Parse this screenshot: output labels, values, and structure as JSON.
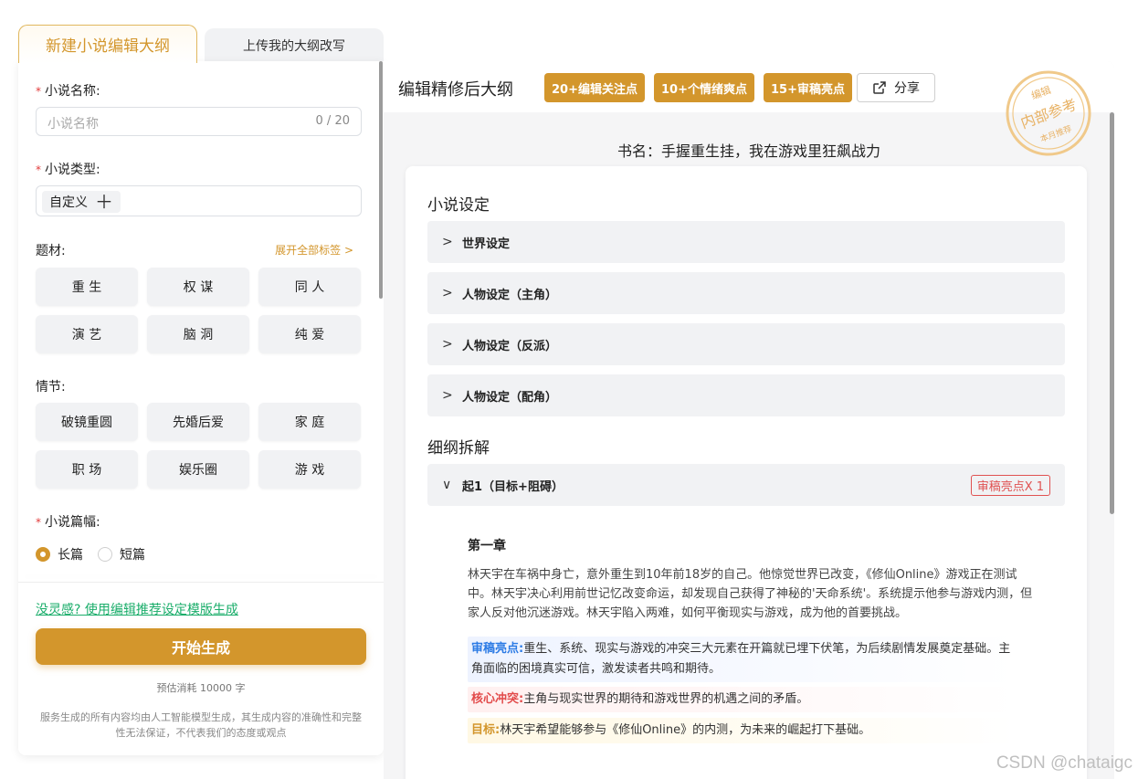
{
  "tabs": {
    "active": "新建小说编辑大纲",
    "inactive": "上传我的大纲改写"
  },
  "left": {
    "name_label": "小说名称:",
    "name_placeholder": "小说名称",
    "name_counter": "0 / 20",
    "type_label": "小说类型:",
    "type_chip": "自定义",
    "theme_label": "题材:",
    "expand_link": "展开全部标签",
    "theme_tags": [
      "重 生",
      "权 谋",
      "同 人",
      "演 艺",
      "脑 洞",
      "纯 爱"
    ],
    "plot_label": "情节:",
    "plot_tags": [
      "破镜重圆",
      "先婚后爱",
      "家 庭",
      "职 场",
      "娱乐圈",
      "游 戏"
    ],
    "length_label": "小说篇幅:",
    "length_options": [
      "长篇",
      "短篇"
    ],
    "length_selected": "长篇",
    "template_link": "没灵感? 使用编辑推荐设定模版生成",
    "start_button": "开始生成",
    "cost": "预估消耗 10000 字",
    "disclaimer": "服务生成的所有内容均由人工智能模型生成，其生成内容的准确性和完整性无法保证，不代表我们的态度或观点"
  },
  "right": {
    "title": "编辑精修后大纲",
    "badges": [
      "20+编辑关注点",
      "10+个情绪爽点",
      "15+审稿亮点"
    ],
    "share": "分享",
    "stamp": {
      "top": "编辑",
      "middle": "内部参考",
      "bottom": "本月推荐"
    },
    "book_title": "书名：手握重生挂，我在游戏里狂飙战力",
    "section1": "小说设定",
    "settings": [
      "世界设定",
      "人物设定（主角）",
      "人物设定（反派）",
      "人物设定（配角）"
    ],
    "section2": "细纲拆解",
    "outline_item": "起1（目标+阻碍）",
    "outline_badge": "审稿亮点X 1",
    "chapter_title": "第一章",
    "chapter_body": "林天宇在车祸中身亡，意外重生到10年前18岁的自己。他惊觉世界已改变，《修仙Online》游戏正在测试中。林天宇决心利用前世记忆改变命运，却发现自己获得了神秘的'天命系统'。系统提示他参与游戏内测，但家人反对他沉迷游戏。林天宇陷入两难，如何平衡现实与游戏，成为他的首要挑战。",
    "highlights": [
      {
        "key": "审稿亮点:",
        "text": "重生、系统、现实与游戏的冲突三大元素在开篇就已埋下伏笔，为后续剧情发展奠定基础。主角面临的困境真实可信，激发读者共鸣和期待。"
      },
      {
        "key": "核心冲突:",
        "text": "主角与现实世界的期待和游戏世界的机遇之间的矛盾。"
      },
      {
        "key": "目标:",
        "text": "林天宇希望能够参与《修仙Online》的内测，为未来的崛起打下基础。"
      }
    ]
  },
  "watermark": "CSDN @chataigc",
  "colors": {
    "accent": "#d3962c",
    "link_green": "#1aad6a",
    "highlight_blue": "#2c7be5",
    "highlight_red": "#e24a4a"
  }
}
